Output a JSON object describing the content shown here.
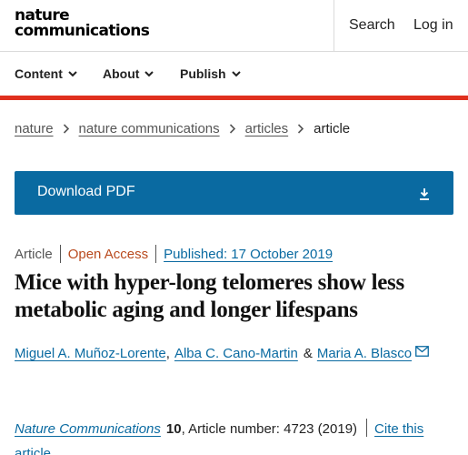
{
  "header": {
    "logo_line1": "nature",
    "logo_line2": "communications",
    "search_label": "Search",
    "login_label": "Log in"
  },
  "nav": {
    "items": [
      {
        "label": "Content",
        "icon": "chevron-down-icon"
      },
      {
        "label": "About",
        "icon": "chevron-down-icon"
      },
      {
        "label": "Publish",
        "icon": "chevron-down-icon"
      }
    ]
  },
  "breadcrumb": {
    "items": [
      "nature",
      "nature communications",
      "articles"
    ],
    "current": "article"
  },
  "download": {
    "label": "Download PDF",
    "icon": "download-icon"
  },
  "article": {
    "type": "Article",
    "access": "Open Access",
    "published": "Published: 17 October 2019",
    "title": "Mice with hyper-long telomeres show less metabolic aging and longer lifespans",
    "authors": [
      "Miguel A. Muñoz-Lorente",
      "Alba C. Cano-Martin",
      "Maria A. Blasco"
    ],
    "author_comma": ",",
    "author_and": "&",
    "contact_icon": "mail-icon"
  },
  "citation": {
    "journal": "Nature Communications",
    "volume": "10",
    "article_number": ", Article number: 4723 (2019)",
    "cite_label": "Cite this article"
  },
  "colors": {
    "accent_red": "#e0301e",
    "link_blue": "#0a6aa1",
    "open_access": "#b94a1e"
  }
}
